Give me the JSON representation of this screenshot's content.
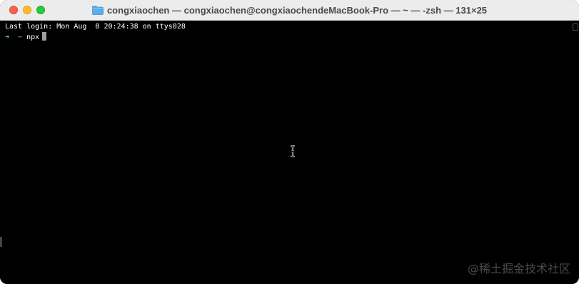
{
  "window": {
    "title": "congxiaochen — congxiaochen@congxiaochendeMacBook-Pro — ~ — -zsh — 131×25",
    "title_icon": "folder-icon"
  },
  "terminal": {
    "last_login": "Last login: Mon Aug  8 20:24:38 on ttys028",
    "prompt_arrow": "➜",
    "prompt_dir": "~",
    "command": "npx",
    "colors": {
      "background": "#000000",
      "text": "#ffffff",
      "arrow": "#5fd75f",
      "dir": "#5fd7d7"
    }
  },
  "watermark": "@稀土掘金技术社区"
}
